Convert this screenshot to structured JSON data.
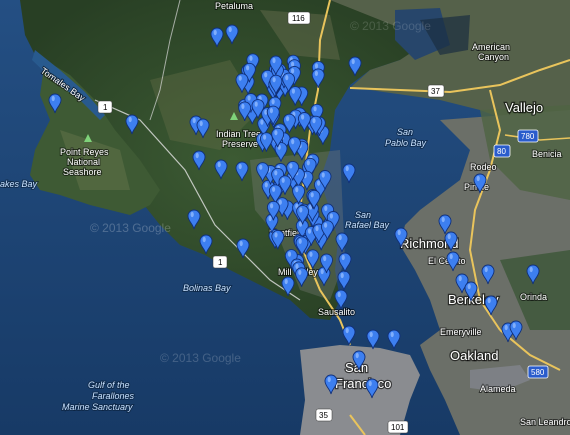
{
  "map": {
    "cities": [
      {
        "id": "petaluma",
        "label": "Petaluma"
      },
      {
        "id": "american-canyon",
        "label": "American Canyon"
      },
      {
        "id": "vallejo",
        "label": "Vallejo"
      },
      {
        "id": "benicia",
        "label": "Benicia"
      },
      {
        "id": "rodeo",
        "label": "Rodeo"
      },
      {
        "id": "pinole",
        "label": "Pinole"
      },
      {
        "id": "richmond",
        "label": "Richmond"
      },
      {
        "id": "el-cerrito",
        "label": "El Cerrito"
      },
      {
        "id": "berkeley",
        "label": "Berkeley"
      },
      {
        "id": "orinda",
        "label": "Orinda"
      },
      {
        "id": "emeryville",
        "label": "Emeryville"
      },
      {
        "id": "oakland",
        "label": "Oakland"
      },
      {
        "id": "alameda",
        "label": "Alameda"
      },
      {
        "id": "san-leandro",
        "label": "San Leandro"
      },
      {
        "id": "san-francisco",
        "label": "San Francisco"
      },
      {
        "id": "sausalito",
        "label": "Sausalito"
      },
      {
        "id": "mill-valley",
        "label": "Mill Valley"
      },
      {
        "id": "kentfield",
        "label": "Kentfield"
      },
      {
        "id": "indian-tree",
        "label": "Indian Tree Preserve"
      },
      {
        "id": "point-reyes",
        "label": "Point Reyes National Seashore"
      },
      {
        "id": "tomales",
        "label": "Tomales Bay"
      },
      {
        "id": "drakes",
        "label": "Drakes Bay"
      }
    ],
    "waters": [
      {
        "id": "san-pablo",
        "label": "San Pablo Bay"
      },
      {
        "id": "san-rafael",
        "label": "San Rafael Bay"
      },
      {
        "id": "bolinas",
        "label": "Bolinas Bay"
      },
      {
        "id": "farallones",
        "label": "Gulf of the Farallones Marine Sanctuary"
      }
    ],
    "routes": [
      "116",
      "1",
      "37",
      "80",
      "780",
      "580",
      "101",
      "35"
    ],
    "watermarks": [
      "© 2013 Google",
      "© 2013 Google",
      "© 2013 Google"
    ],
    "colors": {
      "water": "#1f4a7c",
      "land": "#2f4a2a",
      "marker": "#3d7ff0",
      "urban": "#8d8f93",
      "road": "#f3d27a"
    },
    "marker_count": 146
  }
}
